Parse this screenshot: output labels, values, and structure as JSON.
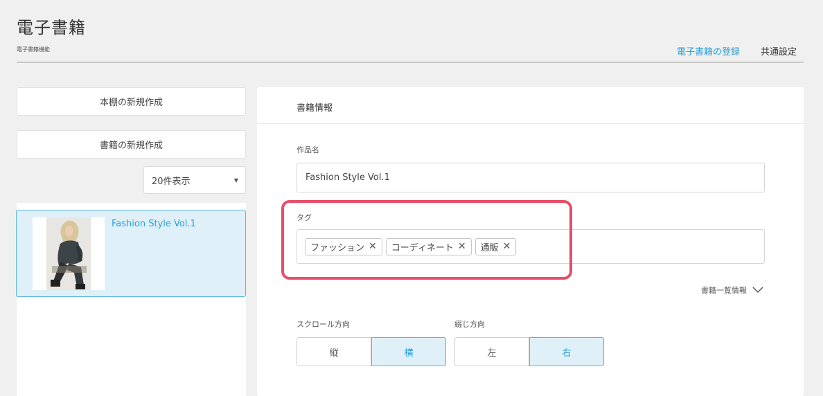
{
  "header": {
    "title": "電子書籍",
    "subtitle": "電子書籍機能",
    "tabs": [
      {
        "label": "電子書籍の登録",
        "active": true
      },
      {
        "label": "共通設定",
        "active": false
      }
    ]
  },
  "sidebar": {
    "new_shelf_button": "本棚の新規作成",
    "new_book_button": "書籍の新規作成",
    "per_page_select": "20件表示",
    "books": [
      {
        "title": "Fashion Style Vol.1",
        "selected": true
      }
    ]
  },
  "form": {
    "section_title": "書籍情報",
    "title_label": "作品名",
    "title_value": "Fashion Style Vol.1",
    "tags_label": "タグ",
    "tags": [
      "ファッション",
      "コーディネート",
      "通販"
    ],
    "list_info_toggle": "書籍一覧情報",
    "scroll_direction_label": "スクロール方向",
    "scroll_options": [
      "縦",
      "横"
    ],
    "scroll_selected": "横",
    "binding_label": "綴じ方向",
    "binding_options": [
      "左",
      "右"
    ],
    "binding_selected": "右"
  },
  "colors": {
    "accent": "#2a9fd6",
    "selected_bg": "#dff0f8",
    "highlight": "#e84e6a"
  }
}
